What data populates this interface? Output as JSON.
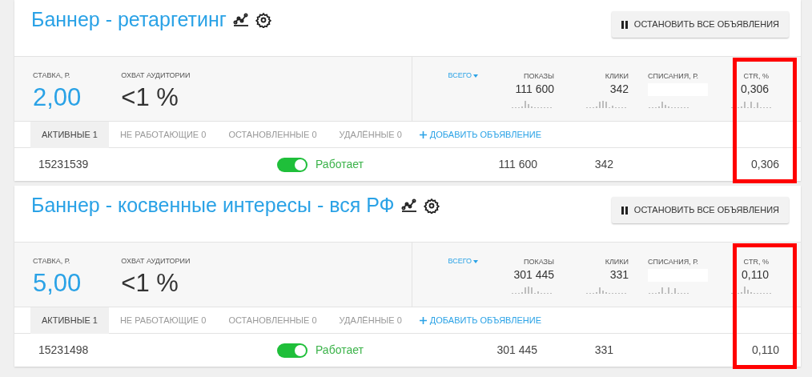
{
  "cards": [
    {
      "title": "Баннер - ретаргетинг",
      "stop_button": "ОСТАНОВИТЬ ВСЕ ОБЪЯВЛЕНИЯ",
      "bid_label": "СТАВКА, Р.",
      "bid_value": "2,00",
      "reach_label": "ОХВАТ АУДИТОРИИ",
      "reach_value": "<1 %",
      "period": "ВСЕГО",
      "ctr_highlighted": true,
      "metrics": [
        {
          "label": "ПОКАЗЫ",
          "value": "111 600",
          "redacted": false
        },
        {
          "label": "КЛИКИ",
          "value": "342",
          "redacted": false
        },
        {
          "label": "СПИСАНИЯ, Р.",
          "redacted": true
        },
        {
          "label": "CTR, %",
          "value": "0,306",
          "redacted": false
        }
      ],
      "tabs": [
        {
          "label": "АКТИВНЫЕ 1",
          "selected": true
        },
        {
          "label": "НЕ РАБОТАЮЩИЕ 0",
          "selected": false
        },
        {
          "label": "ОСТАНОВЛЕННЫЕ 0",
          "selected": false
        },
        {
          "label": "УДАЛЁННЫЕ 0",
          "selected": false
        }
      ],
      "add_link": "ДОБАВИТЬ ОБЪЯВЛЕНИЕ",
      "ads": [
        {
          "id": "15231539",
          "on": true,
          "status": "Работает",
          "shows": "111 600",
          "clicks": "342",
          "ctr": "0,306"
        }
      ]
    },
    {
      "title": "Баннер - косвенные интересы - вся РФ",
      "stop_button": "ОСТАНОВИТЬ ВСЕ ОБЪЯВЛЕНИЯ",
      "bid_label": "СТАВКА, Р.",
      "bid_value": "5,00",
      "reach_label": "ОХВАТ АУДИТОРИИ",
      "reach_value": "<1 %",
      "period": "ВСЕГО",
      "ctr_highlighted": true,
      "metrics": [
        {
          "label": "ПОКАЗЫ",
          "value": "301 445",
          "redacted": false
        },
        {
          "label": "КЛИКИ",
          "value": "331",
          "redacted": false
        },
        {
          "label": "СПИСАНИЯ, Р.",
          "redacted": true
        },
        {
          "label": "CTR, %",
          "value": "0,110",
          "redacted": false
        }
      ],
      "tabs": [
        {
          "label": "АКТИВНЫЕ 1",
          "selected": true
        },
        {
          "label": "НЕ РАБОТАЮЩИЕ 0",
          "selected": false
        },
        {
          "label": "ОСТАНОВЛЕННЫЕ 0",
          "selected": false
        },
        {
          "label": "УДАЛЁННЫЕ 0",
          "selected": false
        }
      ],
      "add_link": "ДОБАВИТЬ ОБЪЯВЛЕНИЕ",
      "ads": [
        {
          "id": "15231498",
          "on": true,
          "status": "Работает",
          "shows": "301 445",
          "clicks": "331",
          "ctr": "0,110"
        }
      ]
    }
  ]
}
